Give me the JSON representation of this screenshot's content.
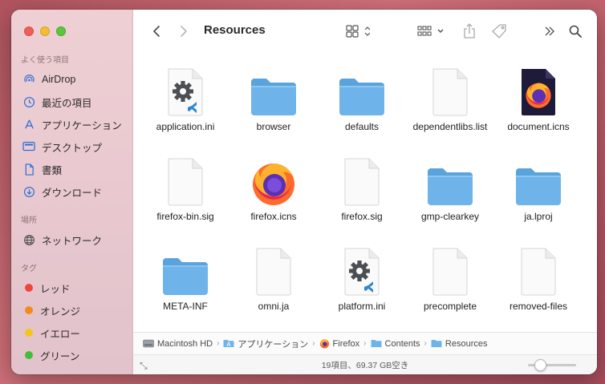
{
  "window": {
    "title": "Resources"
  },
  "sidebar": {
    "sections": [
      {
        "header": "よく使う項目",
        "items": [
          {
            "label": "AirDrop",
            "icon": "airdrop-icon"
          },
          {
            "label": "最近の項目",
            "icon": "clock-icon"
          },
          {
            "label": "アプリケーション",
            "icon": "applications-icon"
          },
          {
            "label": "デスクトップ",
            "icon": "desktop-icon"
          },
          {
            "label": "書類",
            "icon": "document-icon"
          },
          {
            "label": "ダウンロード",
            "icon": "download-icon"
          }
        ]
      },
      {
        "header": "場所",
        "items": [
          {
            "label": "ネットワーク",
            "icon": "network-icon"
          }
        ]
      },
      {
        "header": "タグ",
        "items": [
          {
            "label": "レッド",
            "color": "#f0453a"
          },
          {
            "label": "オレンジ",
            "color": "#f38b1b"
          },
          {
            "label": "イエロー",
            "color": "#f5c518"
          },
          {
            "label": "グリーン",
            "color": "#3fbe3a"
          }
        ]
      }
    ]
  },
  "files": [
    {
      "name": "application.ini",
      "kind": "vscode-doc"
    },
    {
      "name": "browser",
      "kind": "folder"
    },
    {
      "name": "defaults",
      "kind": "folder"
    },
    {
      "name": "dependentlibs.list",
      "kind": "doc"
    },
    {
      "name": "document.icns",
      "kind": "firefox-doc"
    },
    {
      "name": "firefox-bin.sig",
      "kind": "doc"
    },
    {
      "name": "firefox.icns",
      "kind": "firefox"
    },
    {
      "name": "firefox.sig",
      "kind": "doc"
    },
    {
      "name": "gmp-clearkey",
      "kind": "folder"
    },
    {
      "name": "ja.lproj",
      "kind": "folder"
    },
    {
      "name": "META-INF",
      "kind": "folder"
    },
    {
      "name": "omni.ja",
      "kind": "doc"
    },
    {
      "name": "platform.ini",
      "kind": "vscode-doc"
    },
    {
      "name": "precomplete",
      "kind": "doc"
    },
    {
      "name": "removed-files",
      "kind": "doc"
    }
  ],
  "pathbar": [
    {
      "label": "Macintosh HD",
      "icon": "hard-drive-icon"
    },
    {
      "label": "アプリケーション",
      "icon": "applications-folder-icon"
    },
    {
      "label": "Firefox",
      "icon": "firefox-app-icon"
    },
    {
      "label": "Contents",
      "icon": "folder-icon"
    },
    {
      "label": "Resources",
      "icon": "folder-icon"
    }
  ],
  "status": {
    "text": "19項目、69.37 GB空き",
    "icon_size": 0.25
  },
  "colors": {
    "folder": "#6eb4ea",
    "accent": "#2f6fd6"
  }
}
